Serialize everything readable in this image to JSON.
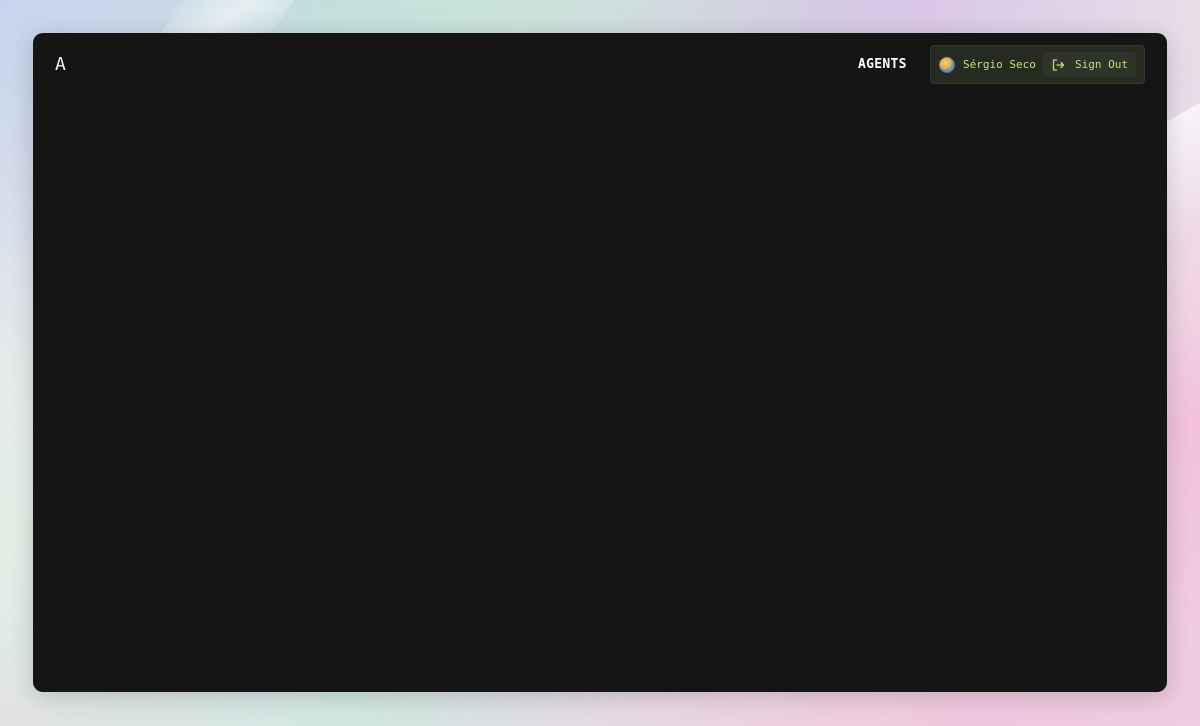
{
  "header": {
    "logo_text": "A",
    "nav": {
      "agents_label": "AGENTS"
    },
    "user": {
      "name": "Sérgio Seco",
      "avatar_icon": "avatar-emoji-icon",
      "signout_label": "Sign Out",
      "signout_icon": "sign-out-icon"
    }
  },
  "colors": {
    "window_background": "#151515",
    "user_panel_background": "#262a21",
    "accent_text": "#b6e07a",
    "nav_text": "#ffffff"
  }
}
